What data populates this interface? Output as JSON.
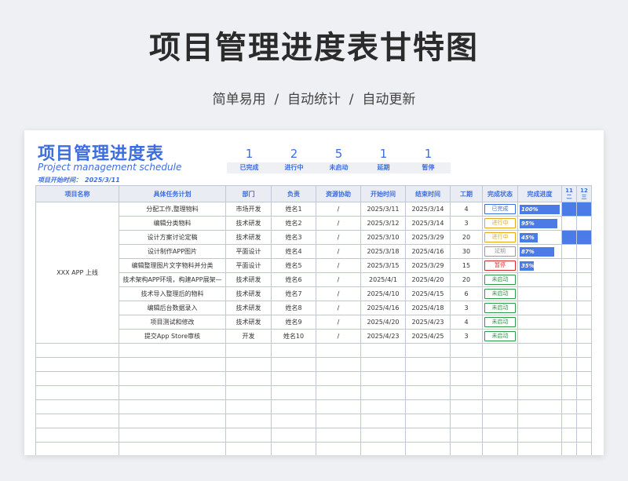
{
  "header": {
    "title": "项目管理进度表甘特图",
    "subtitle": "简单易用  /  自动统计  /  自动更新"
  },
  "sheet": {
    "title": "项目管理进度表",
    "subtitle": "Project management schedule",
    "start_date_label": "项目开始时间：",
    "start_date": "2025/3/11"
  },
  "stats": [
    {
      "value": "1",
      "label": "已完成"
    },
    {
      "value": "2",
      "label": "进行中"
    },
    {
      "value": "5",
      "label": "未启动"
    },
    {
      "value": "1",
      "label": "延期"
    },
    {
      "value": "1",
      "label": "暂停"
    }
  ],
  "columns": [
    "项目名称",
    "具体任务计划",
    "部门",
    "负责",
    "资源协助",
    "开始时间",
    "结束时间",
    "工期",
    "完成状态",
    "完成进度"
  ],
  "gantt_days": [
    {
      "num": "11",
      "weekday": "二"
    },
    {
      "num": "12",
      "weekday": "三"
    }
  ],
  "project_name": "XXX APP 上线",
  "colors": {
    "accent": "#3d6ee0",
    "bar": "#4a7be6"
  },
  "status_styles": {
    "已完成": {
      "color": "#3d6ee0"
    },
    "进行中": {
      "color": "#e6a817"
    },
    "延期": {
      "color": "#9a9a9a"
    },
    "暂停": {
      "color": "#d42a2a"
    },
    "未启动": {
      "color": "#2e9b4a"
    }
  },
  "tasks": [
    {
      "task": "分配工作,整理物料",
      "dept": "市场开发",
      "owner": "姓名1",
      "resource": "/",
      "start": "2025/3/11",
      "end": "2025/3/14",
      "days": "4",
      "status": "已完成",
      "progress": 100,
      "progress_label": "100%",
      "gantt": [
        1,
        1
      ]
    },
    {
      "task": "编辑分类物料",
      "dept": "技术研发",
      "owner": "姓名2",
      "resource": "/",
      "start": "2025/3/12",
      "end": "2025/3/14",
      "days": "3",
      "status": "进行中",
      "progress": 95,
      "progress_label": "95%",
      "gantt": [
        0,
        0
      ]
    },
    {
      "task": "设计方案讨论定稿",
      "dept": "技术研发",
      "owner": "姓名3",
      "resource": "/",
      "start": "2025/3/10",
      "end": "2025/3/29",
      "days": "20",
      "status": "进行中",
      "progress": 45,
      "progress_label": "45%",
      "gantt": [
        1,
        1
      ]
    },
    {
      "task": "设计制作APP图片",
      "dept": "平面设计",
      "owner": "姓名4",
      "resource": "/",
      "start": "2025/3/18",
      "end": "2025/4/16",
      "days": "30",
      "status": "延期",
      "progress": 87,
      "progress_label": "87%",
      "gantt": [
        0,
        0
      ]
    },
    {
      "task": "编辑整理图片文字物料并分类",
      "dept": "平面设计",
      "owner": "姓名5",
      "resource": "/",
      "start": "2025/3/15",
      "end": "2025/3/29",
      "days": "15",
      "status": "暂停",
      "progress": 35,
      "progress_label": "35%",
      "gantt": [
        0,
        0
      ]
    },
    {
      "task": "技术架构APP环境，构建APP展架—",
      "dept": "技术研发",
      "owner": "姓名6",
      "resource": "/",
      "start": "2025/4/1",
      "end": "2025/4/20",
      "days": "20",
      "status": "未启动",
      "progress": 0,
      "progress_label": "",
      "gantt": [
        0,
        0
      ]
    },
    {
      "task": "技术导入整理后的物料",
      "dept": "技术研发",
      "owner": "姓名7",
      "resource": "/",
      "start": "2025/4/10",
      "end": "2025/4/15",
      "days": "6",
      "status": "未启动",
      "progress": 0,
      "progress_label": "",
      "gantt": [
        0,
        0
      ]
    },
    {
      "task": "编辑后台数据录入",
      "dept": "技术研发",
      "owner": "姓名8",
      "resource": "/",
      "start": "2025/4/16",
      "end": "2025/4/18",
      "days": "3",
      "status": "未启动",
      "progress": 0,
      "progress_label": "",
      "gantt": [
        0,
        0
      ]
    },
    {
      "task": "项目测试和修改",
      "dept": "技术研发",
      "owner": "姓名9",
      "resource": "/",
      "start": "2025/4/20",
      "end": "2025/4/23",
      "days": "4",
      "status": "未启动",
      "progress": 0,
      "progress_label": "",
      "gantt": [
        0,
        0
      ]
    },
    {
      "task": "提交App Store审核",
      "dept": "开发",
      "owner": "姓名10",
      "resource": "/",
      "start": "2025/4/23",
      "end": "2025/4/25",
      "days": "3",
      "status": "未启动",
      "progress": 0,
      "progress_label": "",
      "gantt": [
        0,
        0
      ]
    }
  ],
  "empty_rows": 8
}
